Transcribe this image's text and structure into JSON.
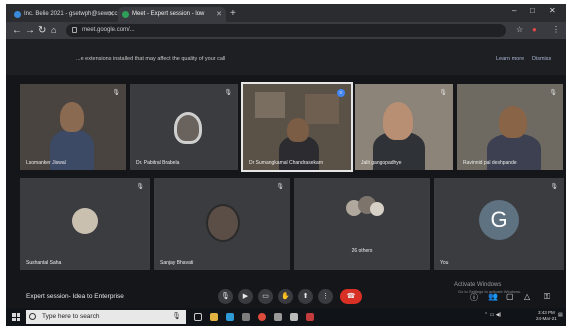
{
  "browser": {
    "tabs": [
      {
        "label": "Inc. Belie 2021 - gsetwph@sewncc"
      },
      {
        "label": "Meet - Expert session - low"
      }
    ],
    "new_tab": "+",
    "url": "meet.google.com/...",
    "minimize": "–",
    "maximize": "□",
    "close": "✕"
  },
  "banner": {
    "text": "...e extensions installed that may affect the quality of your call",
    "learn_more": "Learn more",
    "dismiss": "Dismiss"
  },
  "participants": [
    {
      "name": "Lsomanker Jiswal"
    },
    {
      "name": "Dr. Pabitral Brabela"
    },
    {
      "name": "Dr Sumangkamal Chandrasekarn"
    },
    {
      "name": "Jalit gangopadhye"
    },
    {
      "name": "Ravinnid pal deshpande"
    },
    {
      "name": "Sushantal Saha"
    },
    {
      "name": "Sanjay Bhavati"
    },
    {
      "name": "You",
      "avatar_letter": "G"
    }
  ],
  "others_tile": {
    "label": "26 others"
  },
  "meeting": {
    "title": "Expert session- Idea to Enterprise"
  },
  "watermark": {
    "line1": "Activate Windows",
    "line2": "Go to Settings to activate Windows."
  },
  "taskbar": {
    "search_placeholder": "Type here to search",
    "time": "3:43 PM",
    "date": "24-Mar-21"
  }
}
